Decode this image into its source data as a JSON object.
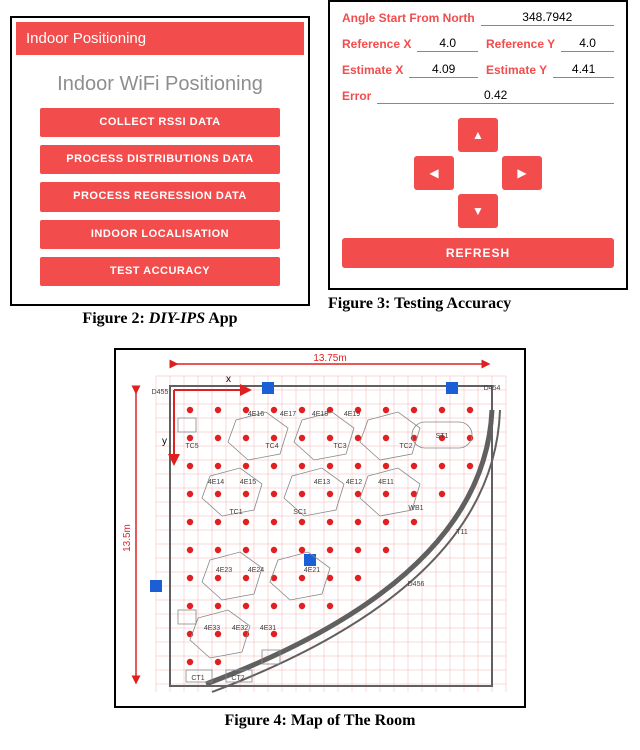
{
  "fig2": {
    "caption_prefix": "Figure 2: ",
    "caption_app": "DIY-IPS",
    "caption_suffix": " App",
    "header": "Indoor Positioning",
    "subtitle": "Indoor WiFi Positioning",
    "buttons": [
      "COLLECT RSSI DATA",
      "PROCESS DISTRIBUTIONS DATA",
      "PROCESS REGRESSION DATA",
      "INDOOR LOCALISATION",
      "TEST ACCURACY"
    ]
  },
  "fig3": {
    "caption": "Figure 3: Testing Accuracy",
    "angle_label": "Angle Start From North",
    "angle_value": "348.7942",
    "refx_label": "Reference X",
    "refx_value": "4.0",
    "refy_label": "Reference Y",
    "refy_value": "4.0",
    "estx_label": "Estimate X",
    "estx_value": "4.09",
    "esty_label": "Estimate Y",
    "esty_value": "4.41",
    "error_label": "Error",
    "error_value": "0.42",
    "refresh": "REFRESH"
  },
  "fig4": {
    "caption": "Figure 4: Map of The Room",
    "width_label": "13.75m",
    "height_label": "13.5m",
    "x_axis": "x",
    "y_axis": "y",
    "room_labels": [
      "4E16",
      "4E17",
      "4E18",
      "4E19",
      "4E14",
      "4E15",
      "4E11",
      "4E12",
      "4E13",
      "4E23",
      "4E24",
      "4E21",
      "4E33",
      "4E32",
      "4E31",
      "TC5",
      "TC4",
      "TC3",
      "TC2",
      "TC1",
      "SC1",
      "WB1",
      "ST1",
      "T11",
      "D454",
      "D455",
      "D456",
      "CT1",
      "CT2"
    ]
  }
}
